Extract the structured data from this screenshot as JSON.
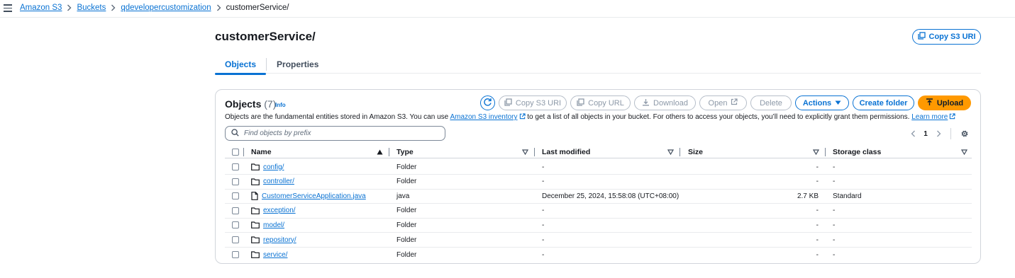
{
  "breadcrumb": {
    "items": [
      "Amazon S3",
      "Buckets",
      "qdevelopercustomization"
    ],
    "current": "customerService/"
  },
  "header": {
    "title": "customerService/",
    "copy_s3_uri_label": "Copy S3 URI"
  },
  "tabs": [
    "Objects",
    "Properties"
  ],
  "objects_panel": {
    "title": "Objects",
    "count": "(7)",
    "info_label": "Info",
    "description_part1": "Objects are the fundamental entities stored in Amazon S3. You can use",
    "inventory_link": "Amazon S3 inventory",
    "description_part2": "to get a list of all objects in your bucket. For others to access your objects, you’ll need to explicitly grant them permissions.",
    "learn_more_link": "Learn more",
    "toolbar": {
      "copy_s3_uri": "Copy S3 URI",
      "copy_url": "Copy URL",
      "download": "Download",
      "open": "Open",
      "delete": "Delete",
      "actions": "Actions",
      "create_folder": "Create folder",
      "upload": "Upload"
    },
    "search": {
      "placeholder": "Find objects by prefix"
    },
    "pagination": {
      "current_page": "1"
    }
  },
  "table": {
    "columns": {
      "name": "Name",
      "type": "Type",
      "last_modified": "Last modified",
      "size": "Size",
      "storage_class": "Storage class"
    },
    "rows": [
      {
        "name": "config/",
        "kind": "folder",
        "type": "Folder",
        "last_modified": "-",
        "size": "-",
        "storage_class": "-"
      },
      {
        "name": "controller/",
        "kind": "folder",
        "type": "Folder",
        "last_modified": "-",
        "size": "-",
        "storage_class": "-"
      },
      {
        "name": "CustomerServiceApplication.java",
        "kind": "file",
        "type": "java",
        "last_modified": "December 25, 2024, 15:58:08 (UTC+08:00)",
        "size": "2.7 KB",
        "storage_class": "Standard"
      },
      {
        "name": "exception/",
        "kind": "folder",
        "type": "Folder",
        "last_modified": "-",
        "size": "-",
        "storage_class": "-"
      },
      {
        "name": "model/",
        "kind": "folder",
        "type": "Folder",
        "last_modified": "-",
        "size": "-",
        "storage_class": "-"
      },
      {
        "name": "repository/",
        "kind": "folder",
        "type": "Folder",
        "last_modified": "-",
        "size": "-",
        "storage_class": "-"
      },
      {
        "name": "service/",
        "kind": "folder",
        "type": "Folder",
        "last_modified": "-",
        "size": "-",
        "storage_class": "-"
      }
    ]
  },
  "colors": {
    "link": "#0972d3",
    "upload_button": "#ff9900",
    "disabled": "#8d99a8",
    "text": "#16191f"
  },
  "icons": [
    "menu-icon",
    "chevron-right-icon",
    "copy-icon",
    "refresh-icon",
    "download-icon",
    "external-link-icon",
    "caret-down-icon",
    "upload-icon",
    "search-icon",
    "chevron-left-icon",
    "settings-icon",
    "sort-ascending-icon",
    "sort-icon",
    "folder-icon",
    "file-icon"
  ]
}
